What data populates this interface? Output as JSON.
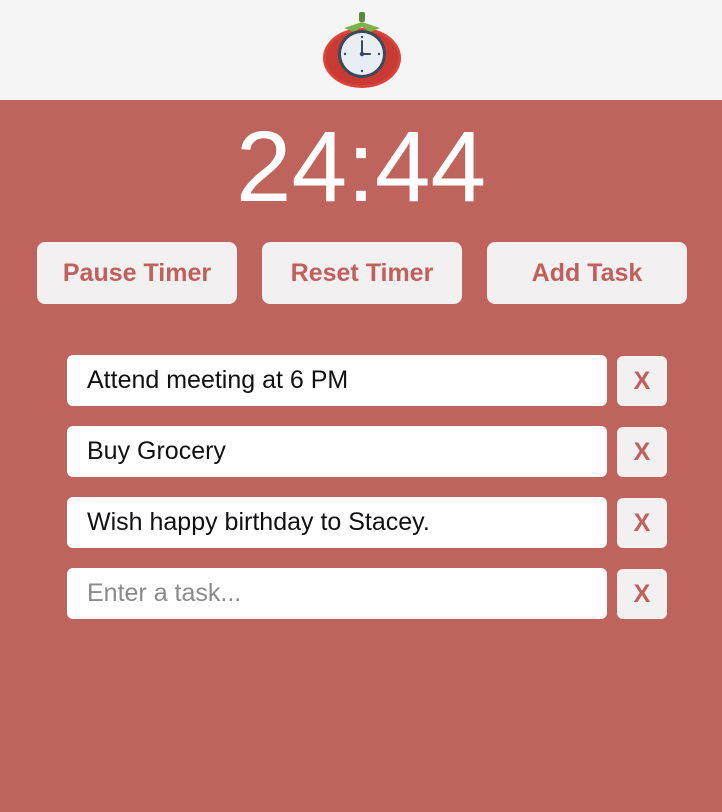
{
  "header": {
    "logo_icon": "tomato-clock-icon"
  },
  "timer": {
    "display": "24:44"
  },
  "controls": {
    "pause_label": "Pause Timer",
    "reset_label": "Reset Timer",
    "add_label": "Add Task"
  },
  "tasks": [
    {
      "value": "Attend meeting at 6 PM",
      "delete_label": "X"
    },
    {
      "value": "Buy Grocery",
      "delete_label": "X"
    },
    {
      "value": "Wish happy birthday to Stacey.",
      "delete_label": "X"
    },
    {
      "value": "",
      "placeholder": "Enter a task...",
      "delete_label": "X"
    }
  ],
  "colors": {
    "background": "#bf635d",
    "header": "#f5f5f5",
    "accent_text": "#c0605c",
    "button_bg": "#f2f0f0"
  }
}
